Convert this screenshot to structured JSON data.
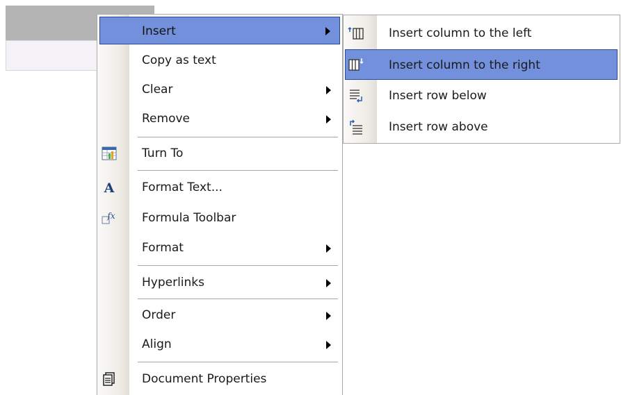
{
  "context_menu": {
    "items": [
      {
        "label": "Insert",
        "has_submenu": true,
        "highlighted": true,
        "icon": ""
      },
      {
        "label": "Copy as text",
        "has_submenu": false,
        "icon": ""
      },
      {
        "label": "Clear",
        "has_submenu": true,
        "icon": ""
      },
      {
        "label": "Remove",
        "has_submenu": true,
        "icon": ""
      },
      {
        "label": "Turn To",
        "has_submenu": false,
        "icon": "chart-icon"
      },
      {
        "label": "Format Text...",
        "has_submenu": false,
        "icon": "format-text-icon"
      },
      {
        "label": "Formula Toolbar",
        "has_submenu": false,
        "icon": "formula-icon"
      },
      {
        "label": "Format",
        "has_submenu": true,
        "icon": ""
      },
      {
        "label": "Hyperlinks",
        "has_submenu": true,
        "icon": ""
      },
      {
        "label": "Order",
        "has_submenu": true,
        "icon": ""
      },
      {
        "label": "Align",
        "has_submenu": true,
        "icon": ""
      },
      {
        "label": "Document Properties",
        "has_submenu": false,
        "icon": "document-properties-icon"
      }
    ]
  },
  "insert_submenu": {
    "items": [
      {
        "label": "Insert column to the left",
        "icon": "insert-column-left-icon"
      },
      {
        "label": "Insert column to the right",
        "icon": "insert-column-right-icon",
        "highlighted": true
      },
      {
        "label": "Insert row below",
        "icon": "insert-row-below-icon"
      },
      {
        "label": "Insert row above",
        "icon": "insert-row-above-icon"
      }
    ]
  },
  "colors": {
    "highlight": "#7390dc",
    "highlight_border": "#2a4a9a",
    "gutter": "#efece6",
    "separator": "#a8a8a8"
  }
}
